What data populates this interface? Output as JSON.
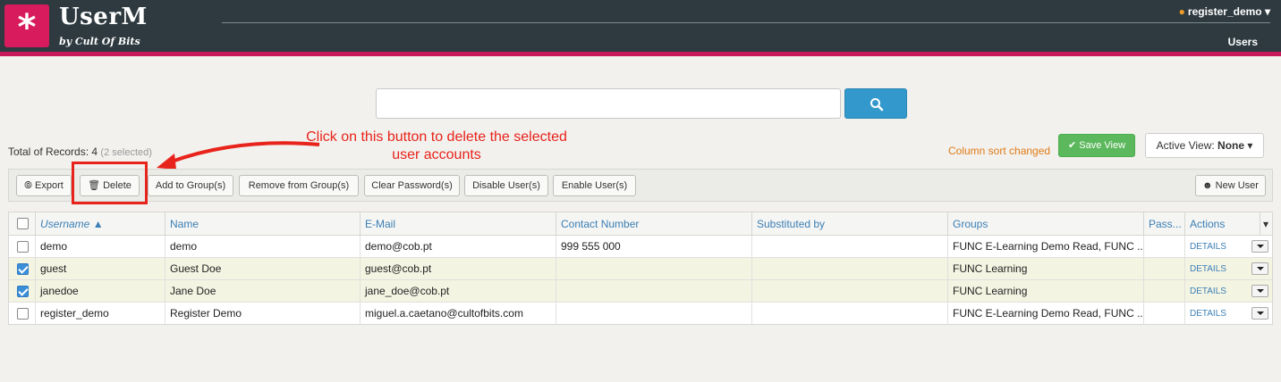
{
  "brand": {
    "logo_glyph": "*",
    "title": "UserM",
    "subtitle": "by Cult Of Bits"
  },
  "header": {
    "user": "register_demo",
    "nav": "Users"
  },
  "search": {
    "value": "",
    "placeholder": ""
  },
  "records": {
    "label": "Total of Records:",
    "count": "4",
    "selected": "(2 selected)"
  },
  "annotation": {
    "text": "Click on this button to delete the selected user accounts"
  },
  "view": {
    "sort_message": "Column sort changed",
    "save_label": "Save View",
    "active_label": "Active View:",
    "active_value": "None"
  },
  "toolbar": {
    "export": "Export",
    "delete": "Delete",
    "add_group": "Add to Group(s)",
    "remove_group": "Remove from Group(s)",
    "clear_password": "Clear Password(s)",
    "disable": "Disable User(s)",
    "enable": "Enable User(s)",
    "new_user": "New User"
  },
  "table": {
    "columns": {
      "username": "Username",
      "name": "Name",
      "email": "E-Mail",
      "contact": "Contact Number",
      "substituted": "Substituted by",
      "groups": "Groups",
      "password": "Pass...",
      "actions": "Actions"
    },
    "rows": [
      {
        "username": "demo",
        "name": "demo",
        "email": "demo@cob.pt",
        "contact": "999 555 000",
        "substituted": "",
        "groups": "FUNC E-Learning Demo Read, FUNC ...",
        "password": "",
        "action": "DETAILS",
        "checked": false
      },
      {
        "username": "guest",
        "name": "Guest Doe",
        "email": "guest@cob.pt",
        "contact": "",
        "substituted": "",
        "groups": "FUNC Learning",
        "password": "",
        "action": "DETAILS",
        "checked": true
      },
      {
        "username": "janedoe",
        "name": "Jane Doe",
        "email": "jane_doe@cob.pt",
        "contact": "",
        "substituted": "",
        "groups": "FUNC Learning",
        "password": "",
        "action": "DETAILS",
        "checked": true
      },
      {
        "username": "register_demo",
        "name": "Register Demo",
        "email": "miguel.a.caetano@cultofbits.com",
        "contact": "",
        "substituted": "",
        "groups": "FUNC E-Learning Demo Read, FUNC ...",
        "password": "",
        "action": "DETAILS",
        "checked": false
      }
    ]
  },
  "colors": {
    "header_bg": "#2e3a40",
    "brand_pink": "#d81b5c",
    "accent_blue": "#3399cc",
    "save_green": "#5cb85c",
    "annotation_red": "#e8231b"
  }
}
